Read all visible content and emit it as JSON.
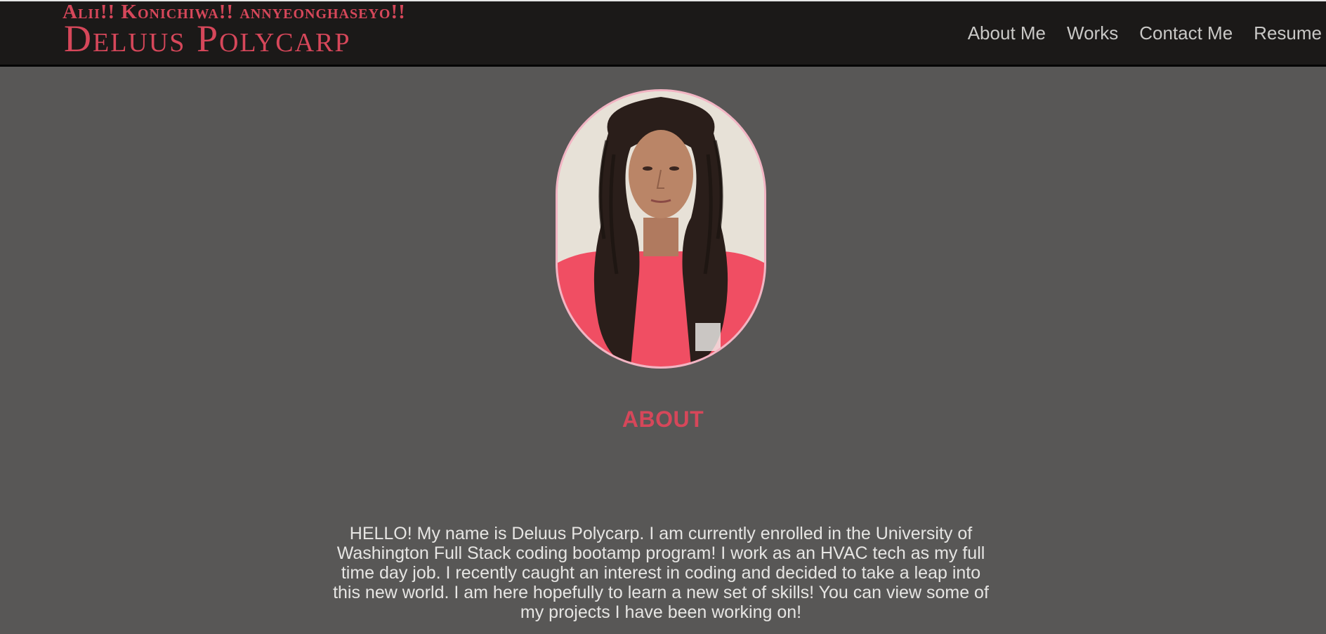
{
  "header": {
    "greeting": "Alii!! Konichiwa!! annyeonghaseyo!!",
    "name": "Deluus Polycarp"
  },
  "nav": {
    "items": [
      {
        "label": "About Me"
      },
      {
        "label": "Works"
      },
      {
        "label": "Contact Me"
      },
      {
        "label": "Resume"
      }
    ]
  },
  "about": {
    "heading": "ABOUT",
    "bio": "HELLO! My name is Deluus Polycarp. I am currently enrolled in the University of Washington Full Stack coding bootamp program! I work as an HVAC tech as my full time day job. I recently caught an interest in coding and decided to take a leap into this new world. I am here hopefully to learn a new set of skills! You can view some of my projects I have been working on!"
  },
  "colors": {
    "background": "#585756",
    "navbar": "#1b1918",
    "accent": "#d6475a",
    "nav_text": "#c9c8c6",
    "portrait_border": "#f2b4c3"
  }
}
